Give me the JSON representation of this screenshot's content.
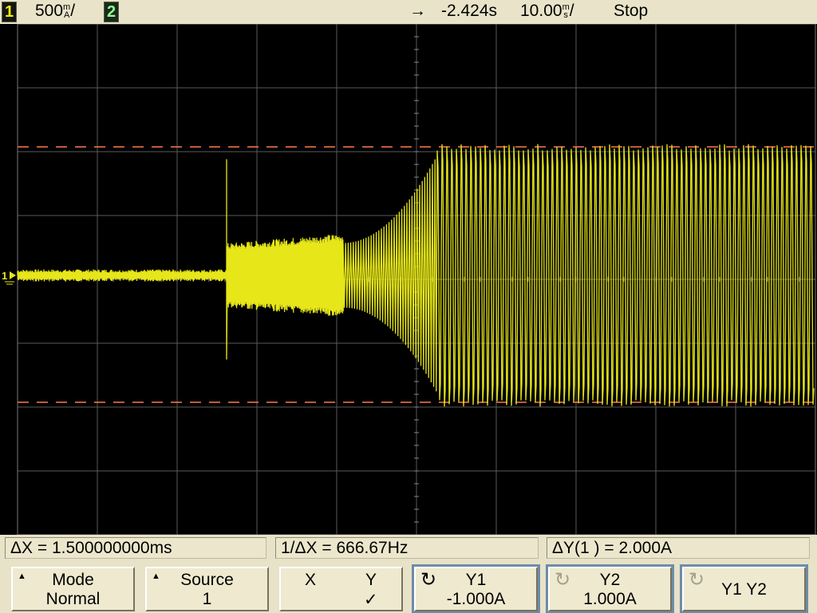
{
  "topbar": {
    "ch1_label": "1",
    "ch1_scale": "500",
    "ch1_unit_top": "m",
    "ch1_unit_bottom": "A",
    "ch1_unit_suffix": "/",
    "ch2_label": "2",
    "trigger_arrow": "→",
    "time_delay": "-2.424s",
    "time_scale": "10.00",
    "time_unit_top": "m",
    "time_unit_bottom": "s",
    "time_unit_suffix": "/",
    "run_state": "Stop"
  },
  "screen": {
    "ground_marker": "1",
    "trace_color": "#e6e61a",
    "cursor_color": "#ff7a4a",
    "grid_color": "#5a5a5a"
  },
  "measurements": {
    "delta_x": "ΔX = 1.500000000ms",
    "inv_delta_x": "1/ΔX = 666.67Hz",
    "delta_y": "ΔY(1 ) = 2.000A"
  },
  "softkeys": {
    "mode": {
      "label": "Mode",
      "value": "Normal"
    },
    "source": {
      "label": "Source",
      "value": "1"
    },
    "xy": {
      "x_label": "X",
      "y_label": "Y",
      "y_check": "✓"
    },
    "y1": {
      "label": "Y1",
      "value": "-1.000A",
      "icon": "rotate-knob-icon"
    },
    "y2": {
      "label": "Y2",
      "value": "1.000A",
      "icon": "rotate-knob-icon"
    },
    "y1y2": {
      "label": "Y1 Y2",
      "icon": "rotate-knob-icon"
    }
  }
}
